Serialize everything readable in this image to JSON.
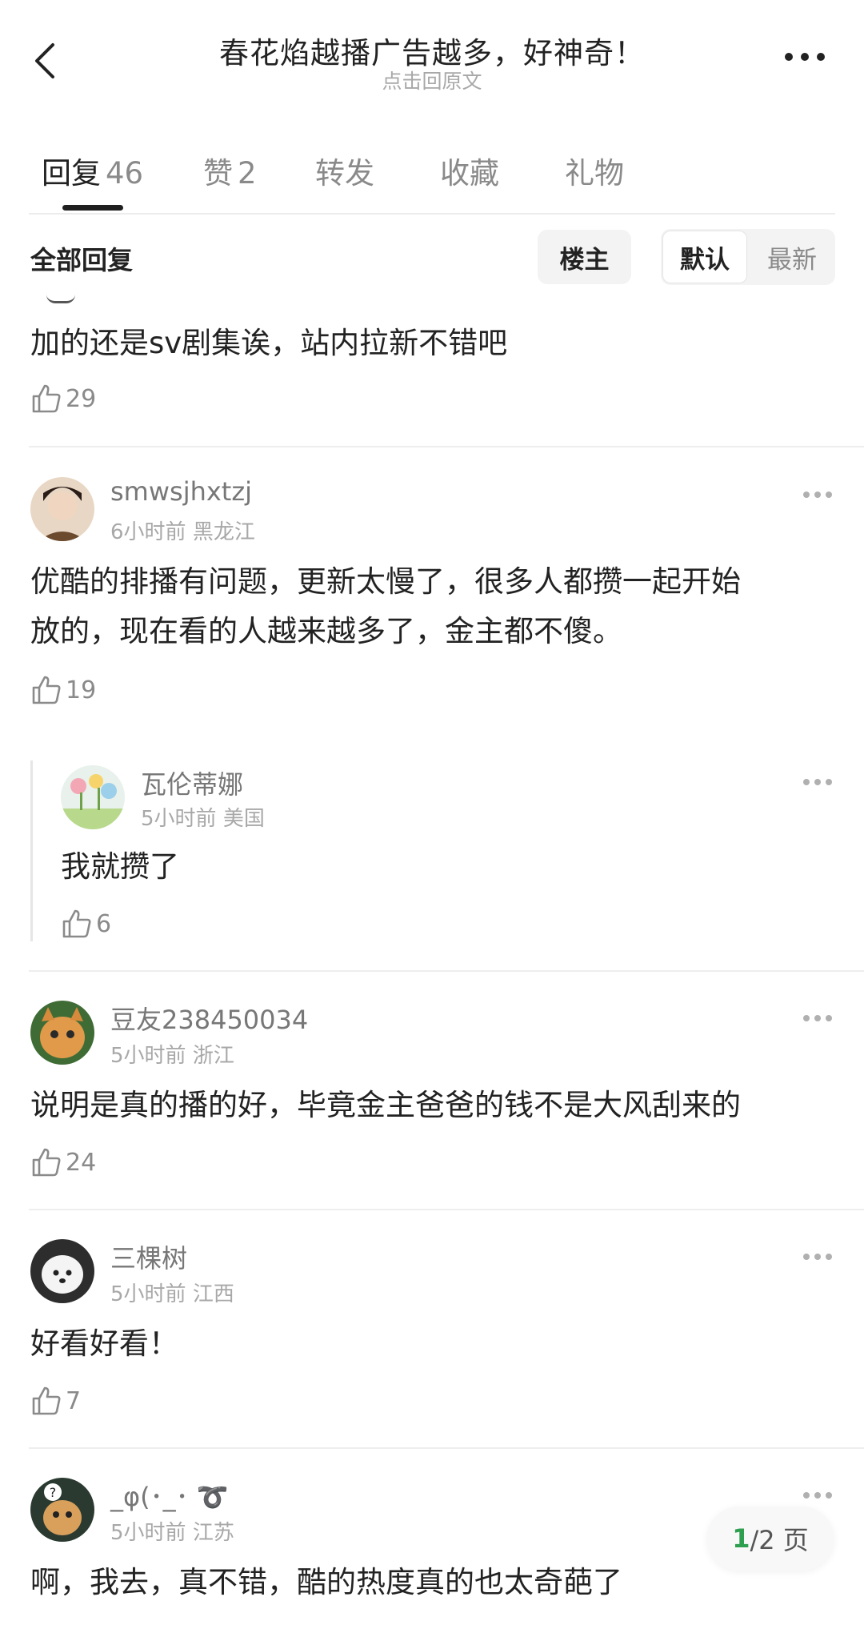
{
  "header": {
    "title": "春花焰越播广告越多，好神奇！",
    "subtitle": "点击回原文"
  },
  "tabs": [
    {
      "label": "回复",
      "count": "46"
    },
    {
      "label": "赞",
      "count": "2"
    },
    {
      "label": "转发",
      "count": ""
    },
    {
      "label": "收藏",
      "count": ""
    },
    {
      "label": "礼物",
      "count": ""
    }
  ],
  "filter": {
    "all_label": "全部回复",
    "owner_label": "楼主",
    "sort_default": "默认",
    "sort_new": "最新"
  },
  "comments": [
    {
      "text": "加的还是sv剧集诶，站内拉新不错吧",
      "likes": "29"
    },
    {
      "user": "smwsjhxtzj",
      "time": "6小时前",
      "location": "黑龙江",
      "text_line1": "优酷的排播有问题，更新太慢了，很多人都攒一起开始",
      "text_line2": "放的，现在看的人越来越多了，金主都不傻。",
      "likes": "19"
    },
    {
      "user": "瓦伦蒂娜",
      "time": "5小时前",
      "location": "美国",
      "text": "我就攒了",
      "likes": "6"
    },
    {
      "user": "豆友238450034",
      "time": "5小时前",
      "location": "浙江",
      "text": "说明是真的播的好，毕竟金主爸爸的钱不是大风刮来的",
      "likes": "24"
    },
    {
      "user": "三棵树",
      "time": "5小时前",
      "location": "江西",
      "text": "好看好看！",
      "likes": "7"
    },
    {
      "user": "_φ(･_･ ➰",
      "time": "5小时前",
      "location": "江苏",
      "text": "啊，我去，真不错，酷的热度真的也太奇葩了"
    }
  ],
  "pagination": {
    "current": "1",
    "total": "/2 页"
  },
  "colors": {
    "accent_green": "#2e9e4f",
    "text_primary": "#222222",
    "text_secondary": "#8a8a8a"
  }
}
